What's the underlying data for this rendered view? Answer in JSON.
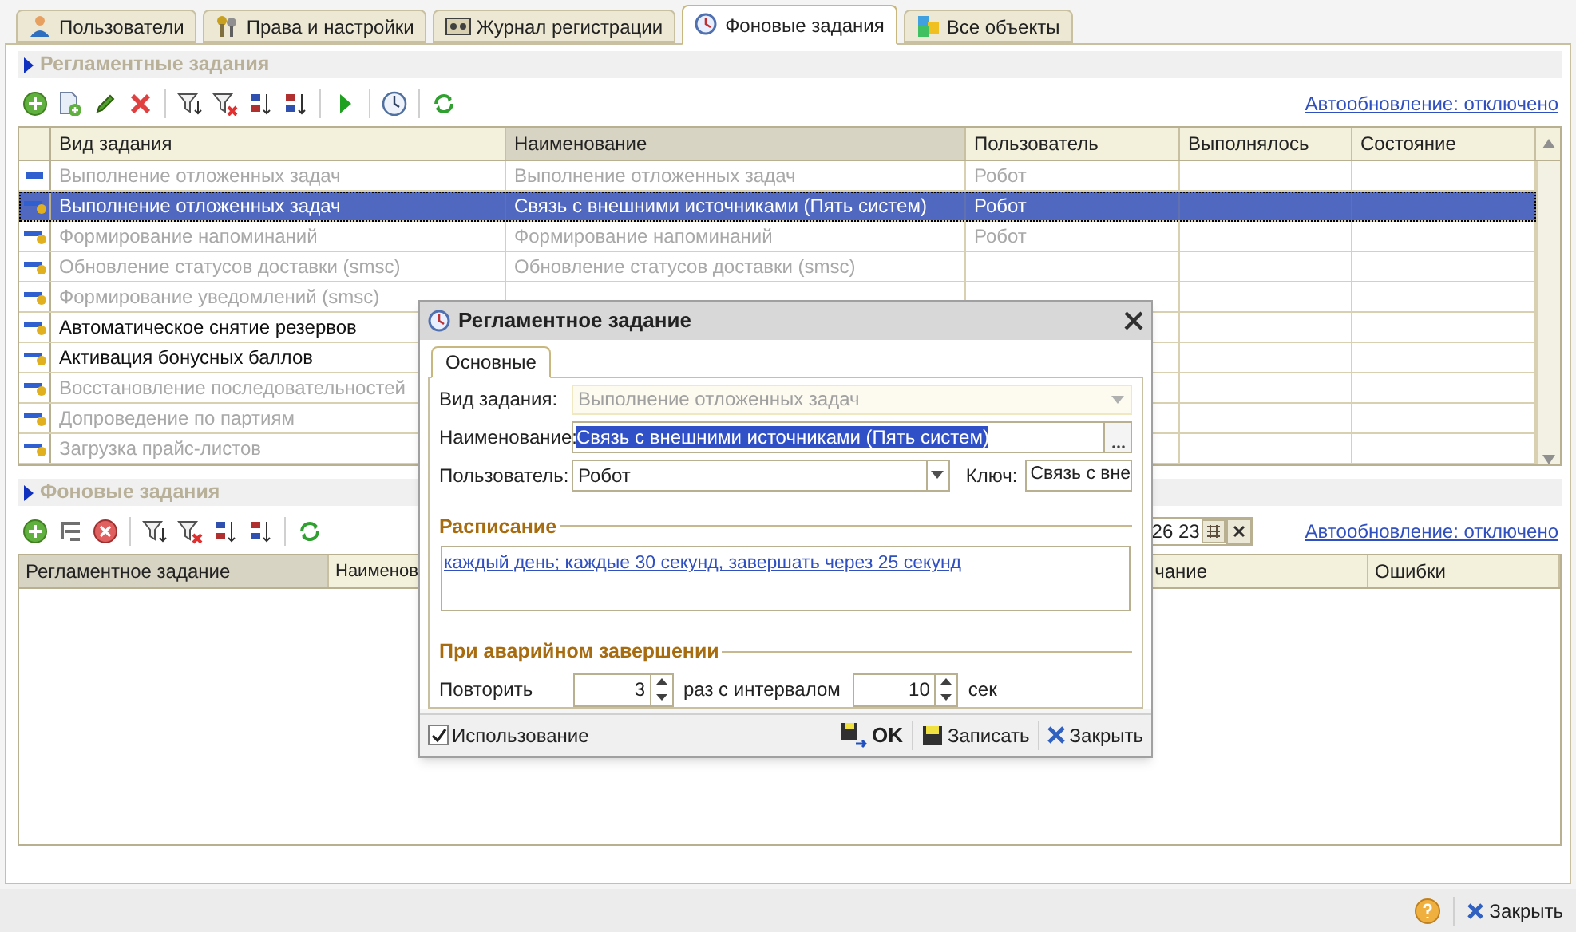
{
  "tabs": [
    {
      "label": "Пользователи",
      "selected": false
    },
    {
      "label": "Права и настройки",
      "selected": false
    },
    {
      "label": "Журнал регистрации",
      "selected": false
    },
    {
      "label": "Фоновые задания",
      "selected": true
    },
    {
      "label": "Все объекты",
      "selected": false
    }
  ],
  "scheduled": {
    "title": "Регламентные задания",
    "autorefresh": "Автообновление: отключено",
    "columns": [
      "Вид задания",
      "Наименование",
      "Пользователь",
      "Выполнялось",
      "Состояние"
    ],
    "rows": [
      {
        "task_type": "Выполнение отложенных задач",
        "name": "Выполнение отложенных задач",
        "user": "Робот",
        "marked": false,
        "disabled": true,
        "selected": false
      },
      {
        "task_type": "Выполнение отложенных задач",
        "name": "Связь с внешними источниками (Пять систем)",
        "user": "Робот",
        "marked": true,
        "disabled": false,
        "selected": true
      },
      {
        "task_type": "Формирование напоминаний",
        "name": "Формирование напоминаний",
        "user": "Робот",
        "marked": true,
        "disabled": true,
        "selected": false
      },
      {
        "task_type": "Обновление статусов доставки (smsc)",
        "name": "Обновление статусов доставки (smsc)",
        "marked": true,
        "disabled": true,
        "selected": false
      },
      {
        "task_type": "Формирование уведомлений (smsc)",
        "marked": true,
        "disabled": true,
        "selected": false
      },
      {
        "task_type": "Автоматическое снятие резервов",
        "marked": true,
        "disabled": false,
        "selected": false
      },
      {
        "task_type": "Активация бонусных баллов",
        "marked": true,
        "disabled": false,
        "selected": false
      },
      {
        "task_type": "Восстановление последовательностей",
        "marked": true,
        "disabled": true,
        "selected": false
      },
      {
        "task_type": "Допроведение по партиям",
        "marked": true,
        "disabled": true,
        "selected": false
      },
      {
        "task_type": "Загрузка прайс-листов",
        "marked": true,
        "disabled": true,
        "selected": false
      }
    ]
  },
  "background": {
    "title": "Фоновые задания",
    "date_value": "26 23",
    "autorefresh": "Автообновление: отключено",
    "columns": [
      "Регламентное задание",
      "Наименов",
      "чание",
      "Ошибки"
    ]
  },
  "dialog": {
    "title": "Регламентное задание",
    "tab": "Основные",
    "job_type": {
      "label": "Вид задания:",
      "value": "Выполнение отложенных задач",
      "disabled": true
    },
    "name": {
      "label": "Наименование:",
      "value": "Связь с внешними источниками (Пять систем)"
    },
    "user": {
      "label": "Пользователь:",
      "value": "Робот"
    },
    "key": {
      "label": "Ключ:",
      "value": "Связь с вне"
    },
    "schedule": {
      "title": "Расписание",
      "text": "каждый день; каждые 30 секунд, завершать через 25 секунд"
    },
    "failure": {
      "title": "При аварийном завершении",
      "repeat_label": "Повторить",
      "repeat_count": "3",
      "interval_label": "раз с интервалом",
      "interval": "10",
      "unit": "сек"
    },
    "use": {
      "label": "Использование",
      "checked": true
    },
    "buttons": [
      {
        "label": "OK",
        "kind": "ok"
      },
      {
        "label": "Записать",
        "kind": "save"
      },
      {
        "label": "Закрыть",
        "kind": "close"
      }
    ]
  },
  "footer": {
    "close": "Закрыть"
  }
}
